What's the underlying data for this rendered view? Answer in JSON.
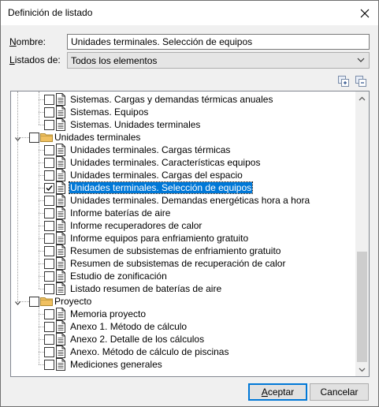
{
  "window": {
    "title": "Definición de listado"
  },
  "form": {
    "name_label": "Nombre:",
    "name_value": "Unidades terminales. Selección de equipos",
    "lists_label": "Listados de:",
    "lists_value": "Todos los elementos"
  },
  "toolbar": {
    "icons": [
      "expand-all-icon",
      "collapse-all-icon"
    ]
  },
  "tree": {
    "nodes": [
      {
        "type": "item",
        "label": "Sistemas. Cargas y demandas térmicas anuales",
        "checked": false
      },
      {
        "type": "item",
        "label": "Sistemas. Equipos",
        "checked": false
      },
      {
        "type": "item",
        "label": "Sistemas. Unidades terminales",
        "checked": false
      },
      {
        "type": "group",
        "label": "Unidades terminales",
        "checked": false,
        "expanded": true
      },
      {
        "type": "item",
        "label": "Unidades terminales. Cargas térmicas",
        "checked": false
      },
      {
        "type": "item",
        "label": "Unidades terminales. Características equipos",
        "checked": false
      },
      {
        "type": "item",
        "label": "Unidades terminales. Cargas del espacio",
        "checked": false
      },
      {
        "type": "item",
        "label": "Unidades terminales. Selección de equipos",
        "checked": true,
        "selected": true
      },
      {
        "type": "item",
        "label": "Unidades terminales. Demandas energéticas hora a hora",
        "checked": false
      },
      {
        "type": "item",
        "label": "Informe baterías de aire",
        "checked": false
      },
      {
        "type": "item",
        "label": "Informe recuperadores de calor",
        "checked": false
      },
      {
        "type": "item",
        "label": "Informe equipos para enfriamiento gratuito",
        "checked": false
      },
      {
        "type": "item",
        "label": "Resumen de subsistemas de enfriamiento gratuito",
        "checked": false
      },
      {
        "type": "item",
        "label": "Resumen de subsistemas de recuperación de calor",
        "checked": false
      },
      {
        "type": "item",
        "label": "Estudio de zonificación",
        "checked": false
      },
      {
        "type": "item",
        "label": "Listado resumen de baterías de aire",
        "checked": false
      },
      {
        "type": "group",
        "label": "Proyecto",
        "checked": false,
        "expanded": true
      },
      {
        "type": "item",
        "label": "Memoria proyecto",
        "checked": false
      },
      {
        "type": "item",
        "label": "Anexo 1. Método de cálculo",
        "checked": false
      },
      {
        "type": "item",
        "label": "Anexo 2. Detalle de los cálculos",
        "checked": false
      },
      {
        "type": "item",
        "label": "Anexo. Método de cálculo de piscinas",
        "checked": false
      },
      {
        "type": "item",
        "label": "Mediciones generales",
        "checked": false
      }
    ]
  },
  "buttons": {
    "accept": "Aceptar",
    "cancel": "Cancelar"
  },
  "colors": {
    "selection": "#0078d7",
    "folder": "#f0c060"
  }
}
